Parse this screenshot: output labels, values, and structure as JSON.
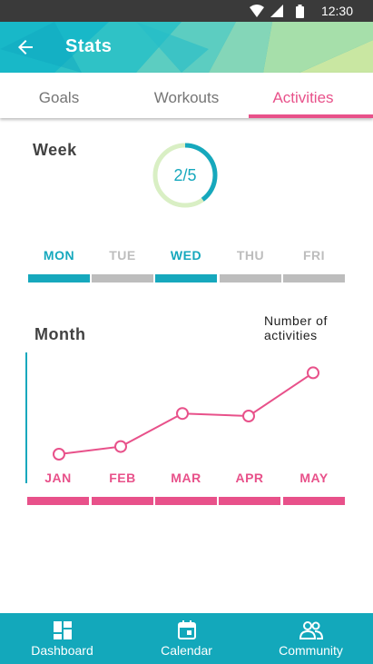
{
  "status_bar": {
    "time": "12:30"
  },
  "app_bar": {
    "title": "Stats"
  },
  "tabs": [
    {
      "label": "Goals",
      "active": false
    },
    {
      "label": "Workouts",
      "active": false
    },
    {
      "label": "Activities",
      "active": true
    }
  ],
  "week": {
    "heading": "Week",
    "progress_text": "2/5",
    "progress_fraction": 0.4,
    "days": [
      {
        "label": "MON",
        "active": true
      },
      {
        "label": "TUE",
        "active": false
      },
      {
        "label": "WED",
        "active": true
      },
      {
        "label": "THU",
        "active": false
      },
      {
        "label": "FRI",
        "active": false
      }
    ]
  },
  "month": {
    "heading": "Month",
    "legend": "Number of activities"
  },
  "chart_data": {
    "type": "line",
    "categories": [
      "JAN",
      "FEB",
      "MAR",
      "APR",
      "MAY"
    ],
    "values": [
      1,
      1.3,
      2.6,
      2.5,
      4.2
    ],
    "ylim": [
      0,
      5
    ],
    "color": "#e8518a"
  },
  "bottom_nav": [
    {
      "label": "Dashboard",
      "icon": "dashboard-icon"
    },
    {
      "label": "Calendar",
      "icon": "calendar-icon"
    },
    {
      "label": "Community",
      "icon": "community-icon"
    }
  ],
  "colors": {
    "accent": "#e8518a",
    "primary": "#16b3c6",
    "inactive": "#bdbdbd"
  }
}
